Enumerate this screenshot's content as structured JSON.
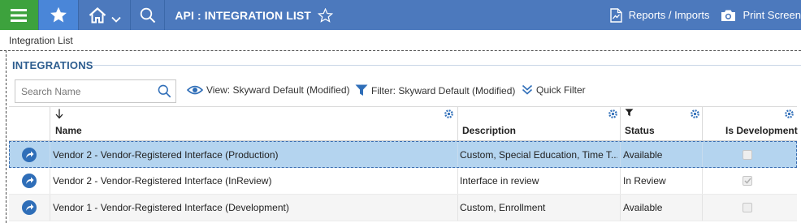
{
  "header": {
    "title": "API : INTEGRATION LIST",
    "reports_label": "Reports / Imports",
    "print_label": "Print Screen"
  },
  "breadcrumb": "Integration List",
  "section": {
    "title": "INTEGRATIONS"
  },
  "toolbar": {
    "search_placeholder": "Search Name",
    "view_label": "View: Skyward Default (Modified)",
    "filter_label": "Filter: Skyward Default (Modified)",
    "quick_filter_label": "Quick Filter"
  },
  "table": {
    "columns": [
      "Name",
      "Description",
      "Status",
      "Is Development"
    ],
    "rows": [
      {
        "name": "Vendor 2 - Vendor-Registered Interface (Production)",
        "description": "Custom, Special Education, Time T...",
        "status": "Available",
        "is_development": false,
        "selected": true
      },
      {
        "name": "Vendor 2 - Vendor-Registered Interface (InReview)",
        "description": "Interface in review",
        "status": "In Review",
        "is_development": true,
        "selected": false
      },
      {
        "name": "Vendor 1 - Vendor-Registered Interface (Development)",
        "description": "Custom, Enrollment",
        "status": "Available",
        "is_development": false,
        "selected": false
      }
    ]
  },
  "colors": {
    "topbar": "#4c79bd",
    "menu_button": "#3da23d",
    "favorites_button": "#4a86d8",
    "section_title": "#2d5d8f",
    "selected_row": "#b4d4ef",
    "icon_blue": "#2f6eb8"
  },
  "icons": [
    "hamburger-icon",
    "star-icon",
    "home-icon",
    "chevron-down-icon",
    "search-icon",
    "star-outline-icon",
    "report-icon",
    "camera-icon",
    "eye-icon",
    "filter-icon",
    "double-chevron-icon",
    "sort-down-arrow-icon",
    "gear-icon",
    "arrow-right-circle-icon"
  ]
}
